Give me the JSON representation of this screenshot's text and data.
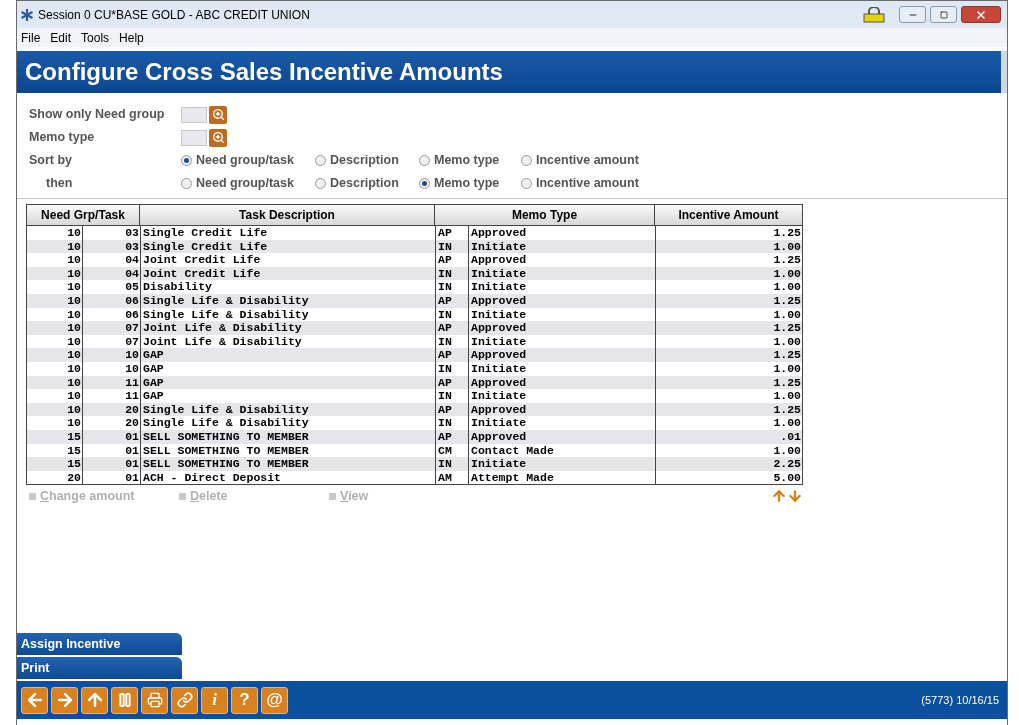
{
  "window": {
    "title": "Session 0 CU*BASE GOLD - ABC CREDIT UNION"
  },
  "menu": [
    "File",
    "Edit",
    "Tools",
    "Help"
  ],
  "page_title": "Configure Cross Sales Incentive Amounts",
  "filters": [
    {
      "label": "Show only Need group"
    },
    {
      "label": "Memo type"
    }
  ],
  "sort_rows": [
    {
      "label": "Sort by",
      "options": [
        {
          "label": "Need group/task",
          "selected": true
        },
        {
          "label": "Description",
          "selected": false
        },
        {
          "label": "Memo type",
          "selected": false
        },
        {
          "label": "Incentive amount",
          "selected": false
        }
      ]
    },
    {
      "label": "then",
      "options": [
        {
          "label": "Need group/task",
          "selected": false
        },
        {
          "label": "Description",
          "selected": false
        },
        {
          "label": "Memo type",
          "selected": true
        },
        {
          "label": "Incentive amount",
          "selected": false
        }
      ]
    }
  ],
  "table": {
    "columns": [
      "Need Grp/Task",
      "Task Description",
      "Memo Type",
      "Incentive Amount"
    ],
    "rows": [
      [
        "10",
        "03",
        "Single Credit Life",
        "AP",
        "Approved",
        "1.25"
      ],
      [
        "10",
        "03",
        "Single Credit Life",
        "IN",
        "Initiate",
        "1.00"
      ],
      [
        "10",
        "04",
        "Joint Credit Life",
        "AP",
        "Approved",
        "1.25"
      ],
      [
        "10",
        "04",
        "Joint Credit Life",
        "IN",
        "Initiate",
        "1.00"
      ],
      [
        "10",
        "05",
        "Disability",
        "IN",
        "Initiate",
        "1.00"
      ],
      [
        "10",
        "06",
        "Single Life & Disability",
        "AP",
        "Approved",
        "1.25"
      ],
      [
        "10",
        "06",
        "Single Life & Disability",
        "IN",
        "Initiate",
        "1.00"
      ],
      [
        "10",
        "07",
        "Joint Life & Disability",
        "AP",
        "Approved",
        "1.25"
      ],
      [
        "10",
        "07",
        "Joint Life & Disability",
        "IN",
        "Initiate",
        "1.00"
      ],
      [
        "10",
        "10",
        "GAP",
        "AP",
        "Approved",
        "1.25"
      ],
      [
        "10",
        "10",
        "GAP",
        "IN",
        "Initiate",
        "1.00"
      ],
      [
        "10",
        "11",
        "GAP",
        "AP",
        "Approved",
        "1.25"
      ],
      [
        "10",
        "11",
        "GAP",
        "IN",
        "Initiate",
        "1.00"
      ],
      [
        "10",
        "20",
        "Single Life & Disability",
        "AP",
        "Approved",
        "1.25"
      ],
      [
        "10",
        "20",
        "Single Life & Disability",
        "IN",
        "Initiate",
        "1.00"
      ],
      [
        "15",
        "01",
        "SELL SOMETHING TO MEMBER",
        "AP",
        "Approved",
        ".01"
      ],
      [
        "15",
        "01",
        "SELL SOMETHING TO MEMBER",
        "CM",
        "Contact Made",
        "1.00"
      ],
      [
        "15",
        "01",
        "SELL SOMETHING TO MEMBER",
        "IN",
        "Initiate",
        "2.25"
      ],
      [
        "20",
        "01",
        "ACH - Direct Deposit",
        "AM",
        "Attempt Made",
        "5.00"
      ]
    ]
  },
  "actions": [
    {
      "label": "Change amount",
      "disabled": true
    },
    {
      "label": "Delete",
      "disabled": true
    },
    {
      "label": "View",
      "disabled": true
    }
  ],
  "side_buttons": [
    "Assign Incentive",
    "Print"
  ],
  "toolbar_glyphs": [
    "i",
    "?",
    "@"
  ],
  "status": "(5773) 10/16/15"
}
